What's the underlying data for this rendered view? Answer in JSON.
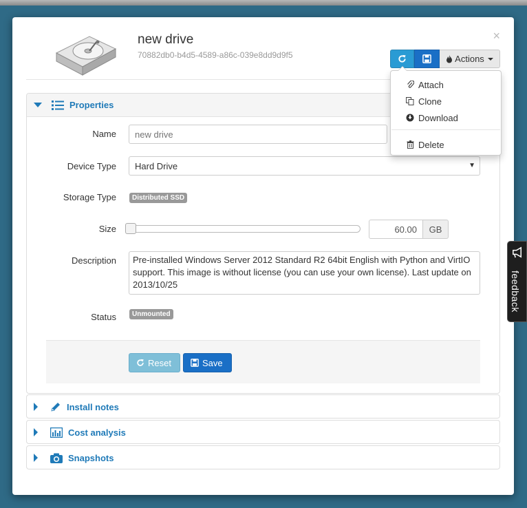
{
  "header": {
    "title": "new drive",
    "uuid": "70882db0-b4d5-4589-a86c-039e8dd9d9f5",
    "close_icon": "×"
  },
  "toolbar": {
    "refresh_icon": "refresh-icon",
    "save_icon": "save-icon",
    "actions_label": "Actions"
  },
  "actions_menu": {
    "items": [
      {
        "label": "Attach",
        "icon": "paperclip-icon"
      },
      {
        "label": "Clone",
        "icon": "copy-icon"
      },
      {
        "label": "Download",
        "icon": "download-icon"
      },
      {
        "label": "Delete",
        "icon": "trash-icon"
      }
    ]
  },
  "properties": {
    "heading": "Properties",
    "name_label": "Name",
    "name_placeholder": "new drive",
    "device_type_label": "Device Type",
    "device_type_value": "Hard Drive",
    "storage_type_label": "Storage Type",
    "storage_type_value": "Distributed SSD",
    "size_label": "Size",
    "size_value": "60.00",
    "size_unit": "GB",
    "size_slider_fraction": 0.0,
    "description_label": "Description",
    "description_value": "Pre-installed Windows Server 2012 Standard R2 64bit English with Python and VirtIO support. This image is without license (you can use your own license). Last update on 2013/10/25",
    "status_label": "Status",
    "status_value": "Unmounted",
    "reset_label": "Reset",
    "save_label": "Save"
  },
  "sections": [
    {
      "label": "Install notes",
      "icon": "pencil-icon"
    },
    {
      "label": "Cost analysis",
      "icon": "bar-chart-icon"
    },
    {
      "label": "Snapshots",
      "icon": "camera-icon"
    }
  ],
  "feedback": {
    "label": "feedback"
  },
  "colors": {
    "accent": "#1f7ab8",
    "primary_button": "#1a6fc6",
    "refresh_button": "#2a9bd4",
    "reset_button": "#7fbfd8",
    "badge": "#999999",
    "backdrop": "#2f6a86"
  }
}
